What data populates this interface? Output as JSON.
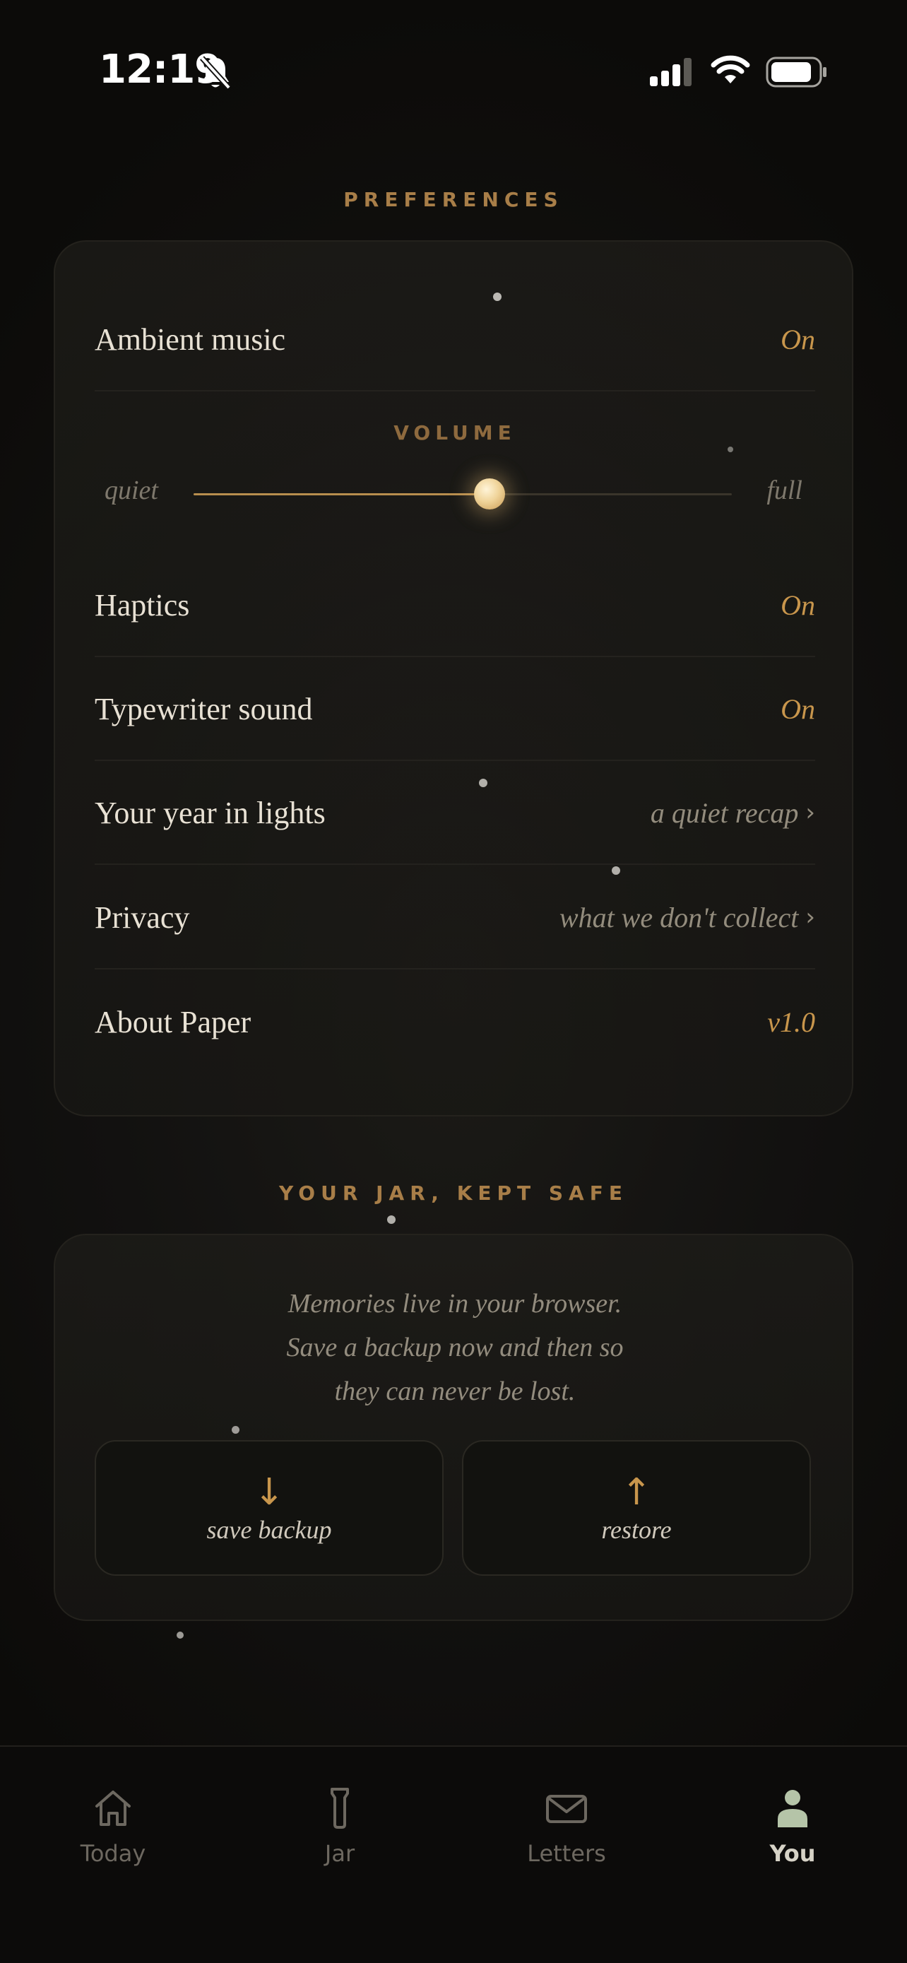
{
  "status_bar": {
    "time": "12:19",
    "icons": [
      "bell-slash-icon",
      "cellular-signal-icon",
      "wifi-icon",
      "battery-icon"
    ]
  },
  "preferences": {
    "heading": "PREFERENCES",
    "ambient_music": {
      "label": "Ambient music",
      "value": "On"
    },
    "volume": {
      "heading": "VOLUME",
      "min_label": "quiet",
      "max_label": "full",
      "level": 0.55
    },
    "haptics": {
      "label": "Haptics",
      "value": "On"
    },
    "typewriter_sound": {
      "label": "Typewriter sound",
      "value": "On"
    },
    "year_in_lights": {
      "label": "Your year in lights",
      "link": "a quiet recap"
    },
    "privacy": {
      "label": "Privacy",
      "link": "what we don't collect"
    },
    "about": {
      "label": "About Paper",
      "value": "v1.0"
    }
  },
  "backup": {
    "heading": "YOUR JAR, KEPT SAFE",
    "message_lines": [
      "Memories live in your browser.",
      "Save a backup now and then so",
      "they can never be lost."
    ],
    "save_button": {
      "icon": "↓",
      "label": "save backup"
    },
    "restore_button": {
      "icon": "↑",
      "label": "restore"
    }
  },
  "tabs": [
    {
      "label": "Today",
      "icon": "home-icon",
      "active": false
    },
    {
      "label": "Jar",
      "icon": "jar-icon",
      "active": false
    },
    {
      "label": "Letters",
      "icon": "envelope-icon",
      "active": false
    },
    {
      "label": "You",
      "icon": "person-icon",
      "active": true
    }
  ],
  "colors": {
    "accent": "#c8964c",
    "heading": "#a87e48",
    "background": "#0d0c0a",
    "active_tab": "#d6d2c6",
    "active_tab_icon": "#b5c4a8"
  }
}
